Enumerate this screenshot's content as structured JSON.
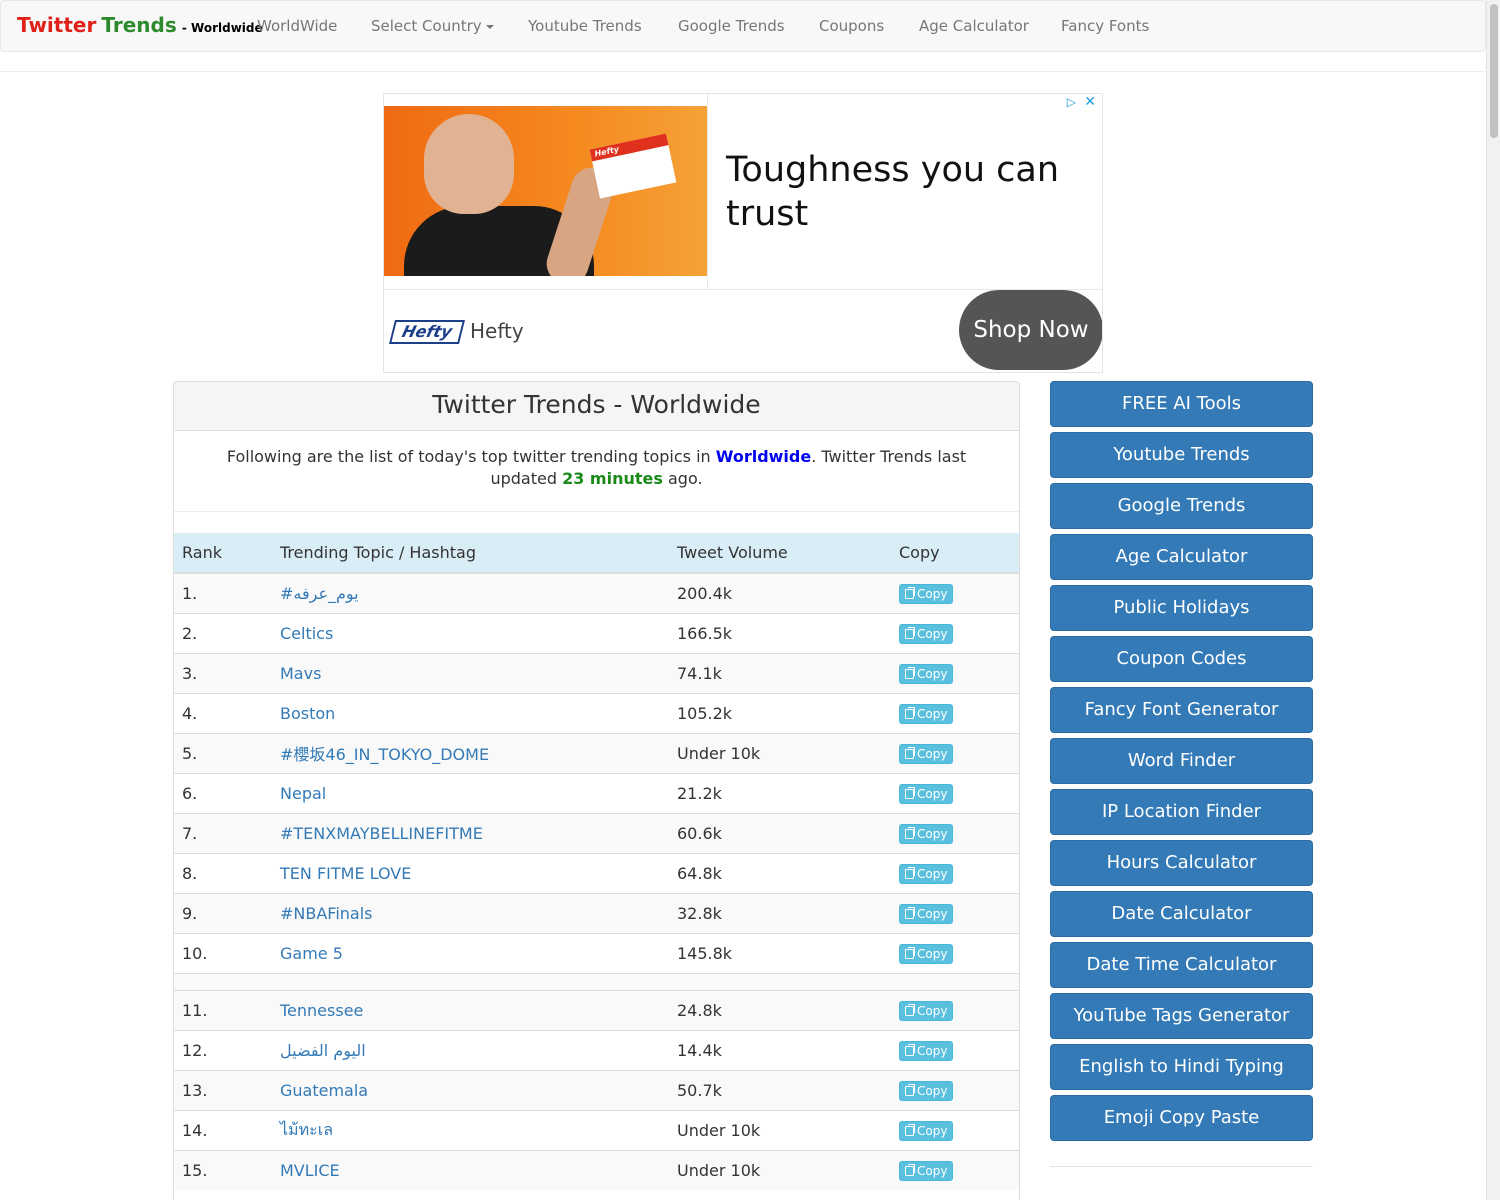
{
  "nav": {
    "brand_main_red": "Twitter",
    "brand_main_green": "Trends",
    "brand_sub": "- Worldwide",
    "items": [
      "WorldWide",
      "Select Country",
      "Youtube Trends",
      "Google Trends",
      "Coupons",
      "Age Calculator",
      "Fancy Fonts"
    ]
  },
  "ad": {
    "headline": "Toughness you can trust",
    "logo_text": "Hefty",
    "brand": "Hefty",
    "cta": "Shop Now",
    "box_logo": "Hefty",
    "colors": {
      "image_bg": "#f06a13",
      "cta_bg": "#555555"
    }
  },
  "panel": {
    "title": "Twitter Trends - Worldwide",
    "intro_before": "Following are the list of today's top twitter trending topics in ",
    "intro_location": "Worldwide",
    "intro_middle": ". Twitter Trends last updated ",
    "intro_minutes": "23 minutes",
    "intro_after": " ago."
  },
  "table": {
    "headers": {
      "rank": "Rank",
      "topic": "Trending Topic / Hashtag",
      "volume": "Tweet Volume",
      "copy": "Copy"
    },
    "copy_label": "Copy",
    "rows": [
      {
        "rank": "1.",
        "topic": "#يوم_عرفه",
        "volume": "200.4k"
      },
      {
        "rank": "2.",
        "topic": "Celtics",
        "volume": "166.5k"
      },
      {
        "rank": "3.",
        "topic": "Mavs",
        "volume": "74.1k"
      },
      {
        "rank": "4.",
        "topic": "Boston",
        "volume": "105.2k"
      },
      {
        "rank": "5.",
        "topic": "#櫻坂46_IN_TOKYO_DOME",
        "volume": "Under 10k"
      },
      {
        "rank": "6.",
        "topic": "Nepal",
        "volume": "21.2k"
      },
      {
        "rank": "7.",
        "topic": "#TENXMAYBELLINEFITME",
        "volume": "60.6k"
      },
      {
        "rank": "8.",
        "topic": "TEN FITME LOVE",
        "volume": "64.8k"
      },
      {
        "rank": "9.",
        "topic": "#NBAFinals",
        "volume": "32.8k"
      },
      {
        "rank": "10.",
        "topic": "Game 5",
        "volume": "145.8k"
      },
      {
        "rank": "11.",
        "topic": "Tennessee",
        "volume": "24.8k"
      },
      {
        "rank": "12.",
        "topic": "اليوم الفضيل",
        "volume": "14.4k"
      },
      {
        "rank": "13.",
        "topic": "Guatemala",
        "volume": "50.7k"
      },
      {
        "rank": "14.",
        "topic": "ไม้ทะเล",
        "volume": "Under 10k"
      },
      {
        "rank": "15.",
        "topic": "MVLICE",
        "volume": "Under 10k"
      }
    ]
  },
  "sidebar": {
    "buttons": [
      "FREE AI Tools",
      "Youtube Trends",
      "Google Trends",
      "Age Calculator",
      "Public Holidays",
      "Coupon Codes",
      "Fancy Font Generator",
      "Word Finder",
      "IP Location Finder",
      "Hours Calculator",
      "Date Calculator",
      "Date Time Calculator",
      "YouTube Tags Generator",
      "English to Hindi Typing",
      "Emoji Copy Paste"
    ]
  },
  "colors": {
    "primary": "#337ab7",
    "copy_button": "#5bc0de",
    "brand_red": "#e0211a",
    "brand_green": "#2d8a2d",
    "header_row": "#d9edf7"
  }
}
